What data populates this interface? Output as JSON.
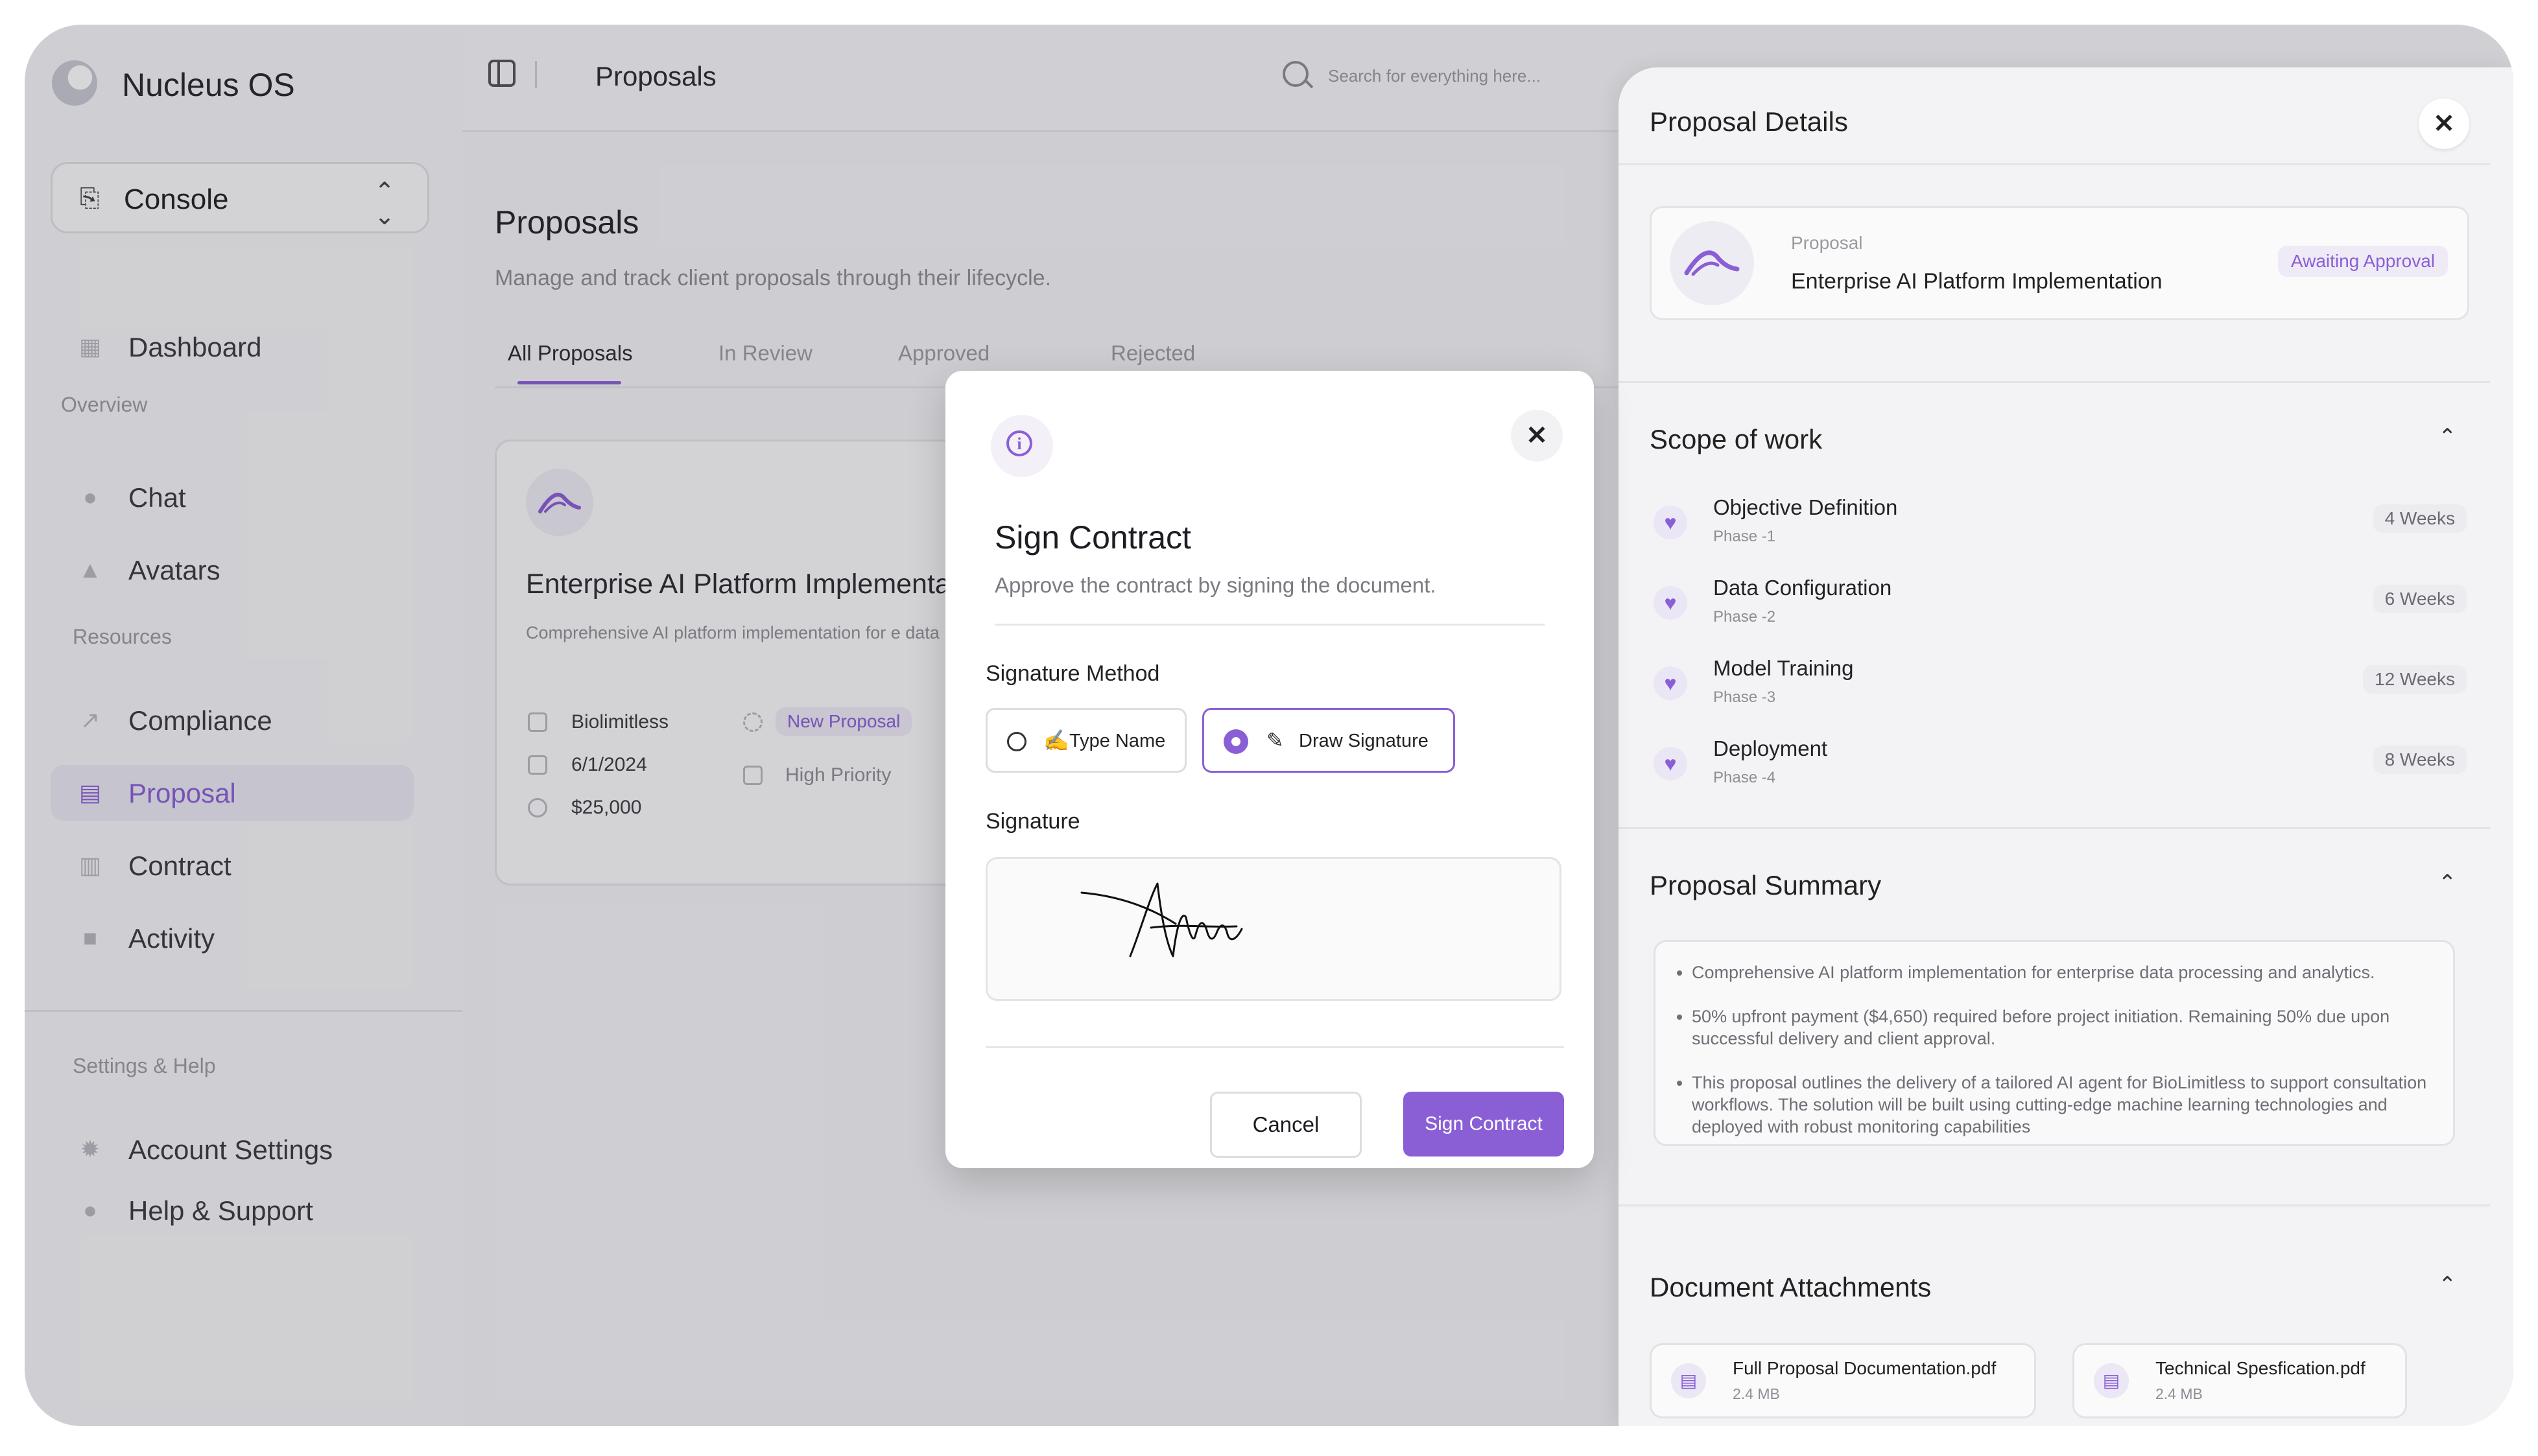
{
  "app": {
    "brand": "Nucleus OS",
    "console_label": "Console"
  },
  "sidebar": {
    "dashboard": "Dashboard",
    "sections": {
      "overview": "Overview",
      "resources": "Resources",
      "settings": "Settings & Help"
    },
    "overview_items": [
      {
        "label": "Chat"
      },
      {
        "label": "Avatars"
      }
    ],
    "resource_items": [
      {
        "label": "Compliance"
      },
      {
        "label": "Proposal"
      },
      {
        "label": "Contract"
      },
      {
        "label": "Activity"
      }
    ],
    "settings_items": [
      {
        "label": "Account Settings"
      },
      {
        "label": "Help & Support"
      }
    ]
  },
  "header": {
    "title": "Proposals",
    "search_placeholder": "Search for everything here..."
  },
  "main": {
    "title": "Proposals",
    "subtitle": "Manage and track client proposals through their lifecycle.",
    "tabs": [
      {
        "label": "All Proposals"
      },
      {
        "label": "In Review"
      },
      {
        "label": "Approved"
      },
      {
        "label": "Rejected"
      }
    ],
    "card": {
      "title": "Enterprise AI Platform Implementa",
      "description": "Comprehensive AI platform implementation for e data processing and analytics.",
      "client": "Biolimitless",
      "date": "6/1/2024",
      "amount": "$25,000",
      "status_tag": "New Proposal",
      "priority": "High Priority"
    }
  },
  "modal": {
    "title": "Sign Contract",
    "subtitle": "Approve the contract by signing the document.",
    "method_label": "Signature Method",
    "options": [
      {
        "label": "Type Name",
        "selected": false
      },
      {
        "label": "Draw Signature",
        "selected": true
      }
    ],
    "signature_label": "Signature",
    "cancel_label": "Cancel",
    "sign_label": "Sign Contract"
  },
  "panel": {
    "title": "Proposal Details",
    "proposal_kicker": "Proposal",
    "proposal_name": "Enterprise AI Platform Implementation",
    "status": "Awaiting Approval",
    "scope_title": "Scope of work",
    "scope": [
      {
        "name": "Objective Definition",
        "phase": "Phase -1",
        "duration": "4 Weeks"
      },
      {
        "name": "Data Configuration",
        "phase": "Phase -2",
        "duration": "6 Weeks"
      },
      {
        "name": "Model Training",
        "phase": "Phase -3",
        "duration": "12 Weeks"
      },
      {
        "name": "Deployment",
        "phase": "Phase -4",
        "duration": "8 Weeks"
      }
    ],
    "summary_title": "Proposal Summary",
    "summary": [
      "Comprehensive AI platform implementation for enterprise data processing and analytics.",
      "50% upfront payment ($4,650) required before project initiation. Remaining 50% due upon successful delivery and client approval.",
      "This proposal outlines the delivery of a tailored AI agent for BioLimitless to support consultation workflows. The solution will be built using cutting-edge machine learning technologies and deployed with robust monitoring capabilities"
    ],
    "attachments_title": "Document Attachments",
    "attachments": [
      {
        "name": "Full Proposal Documentation.pdf",
        "size": "2.4 MB"
      },
      {
        "name": "Technical Spesfication.pdf",
        "size": "2.4 MB"
      }
    ]
  },
  "colors": {
    "accent": "#8a5fd6"
  }
}
